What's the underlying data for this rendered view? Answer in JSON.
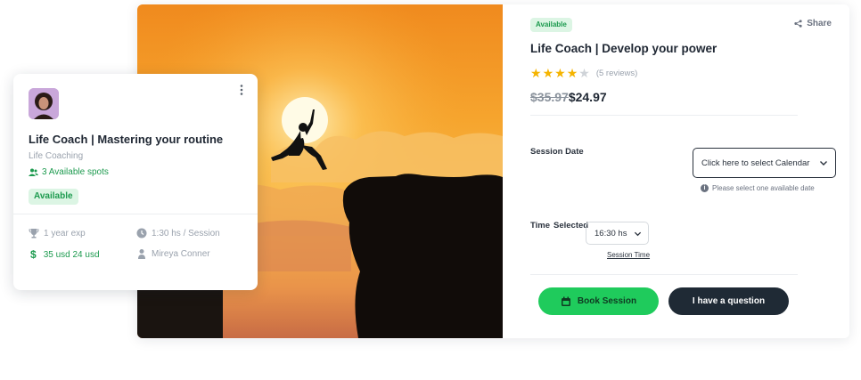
{
  "main": {
    "badge": "Available",
    "share_label": "Share",
    "title": "Life Coach | Develop your power",
    "rating": {
      "stars": 4,
      "max": 5,
      "reviews": "(5 reviews)"
    },
    "price": {
      "old": "$35.97",
      "new": "$24.97"
    },
    "session_date_label": "Session Date",
    "calendar_placeholder": "Click here to select Calendar",
    "date_hint": "Please select one available date",
    "time_label": "Time",
    "time_selected_label": "Selected",
    "time_value": "16:30 hs",
    "session_time_link": "Session Time",
    "book_label": "Book Session",
    "question_label": "I have a question"
  },
  "float_card": {
    "title": "Life Coach | Mastering your routine",
    "category": "Life Coaching",
    "spots": "3 Available spots",
    "badge": "Available",
    "experience": "1 year exp",
    "duration": "1:30 hs / Session",
    "price": "35 usd 24 usd",
    "coach": "Mireya Conner"
  },
  "colors": {
    "accent_green": "#1fcb5c",
    "dark": "#1f2a35",
    "star": "#f5b400",
    "badge_bg": "#dcf5e4",
    "badge_text": "#1c9a4e"
  },
  "icons": [
    "share-icon",
    "star-icon",
    "chevron-down-icon",
    "info-icon",
    "calendar-icon",
    "kebab-menu-icon",
    "users-icon",
    "trophy-icon",
    "clock-icon",
    "dollar-icon",
    "user-icon"
  ]
}
